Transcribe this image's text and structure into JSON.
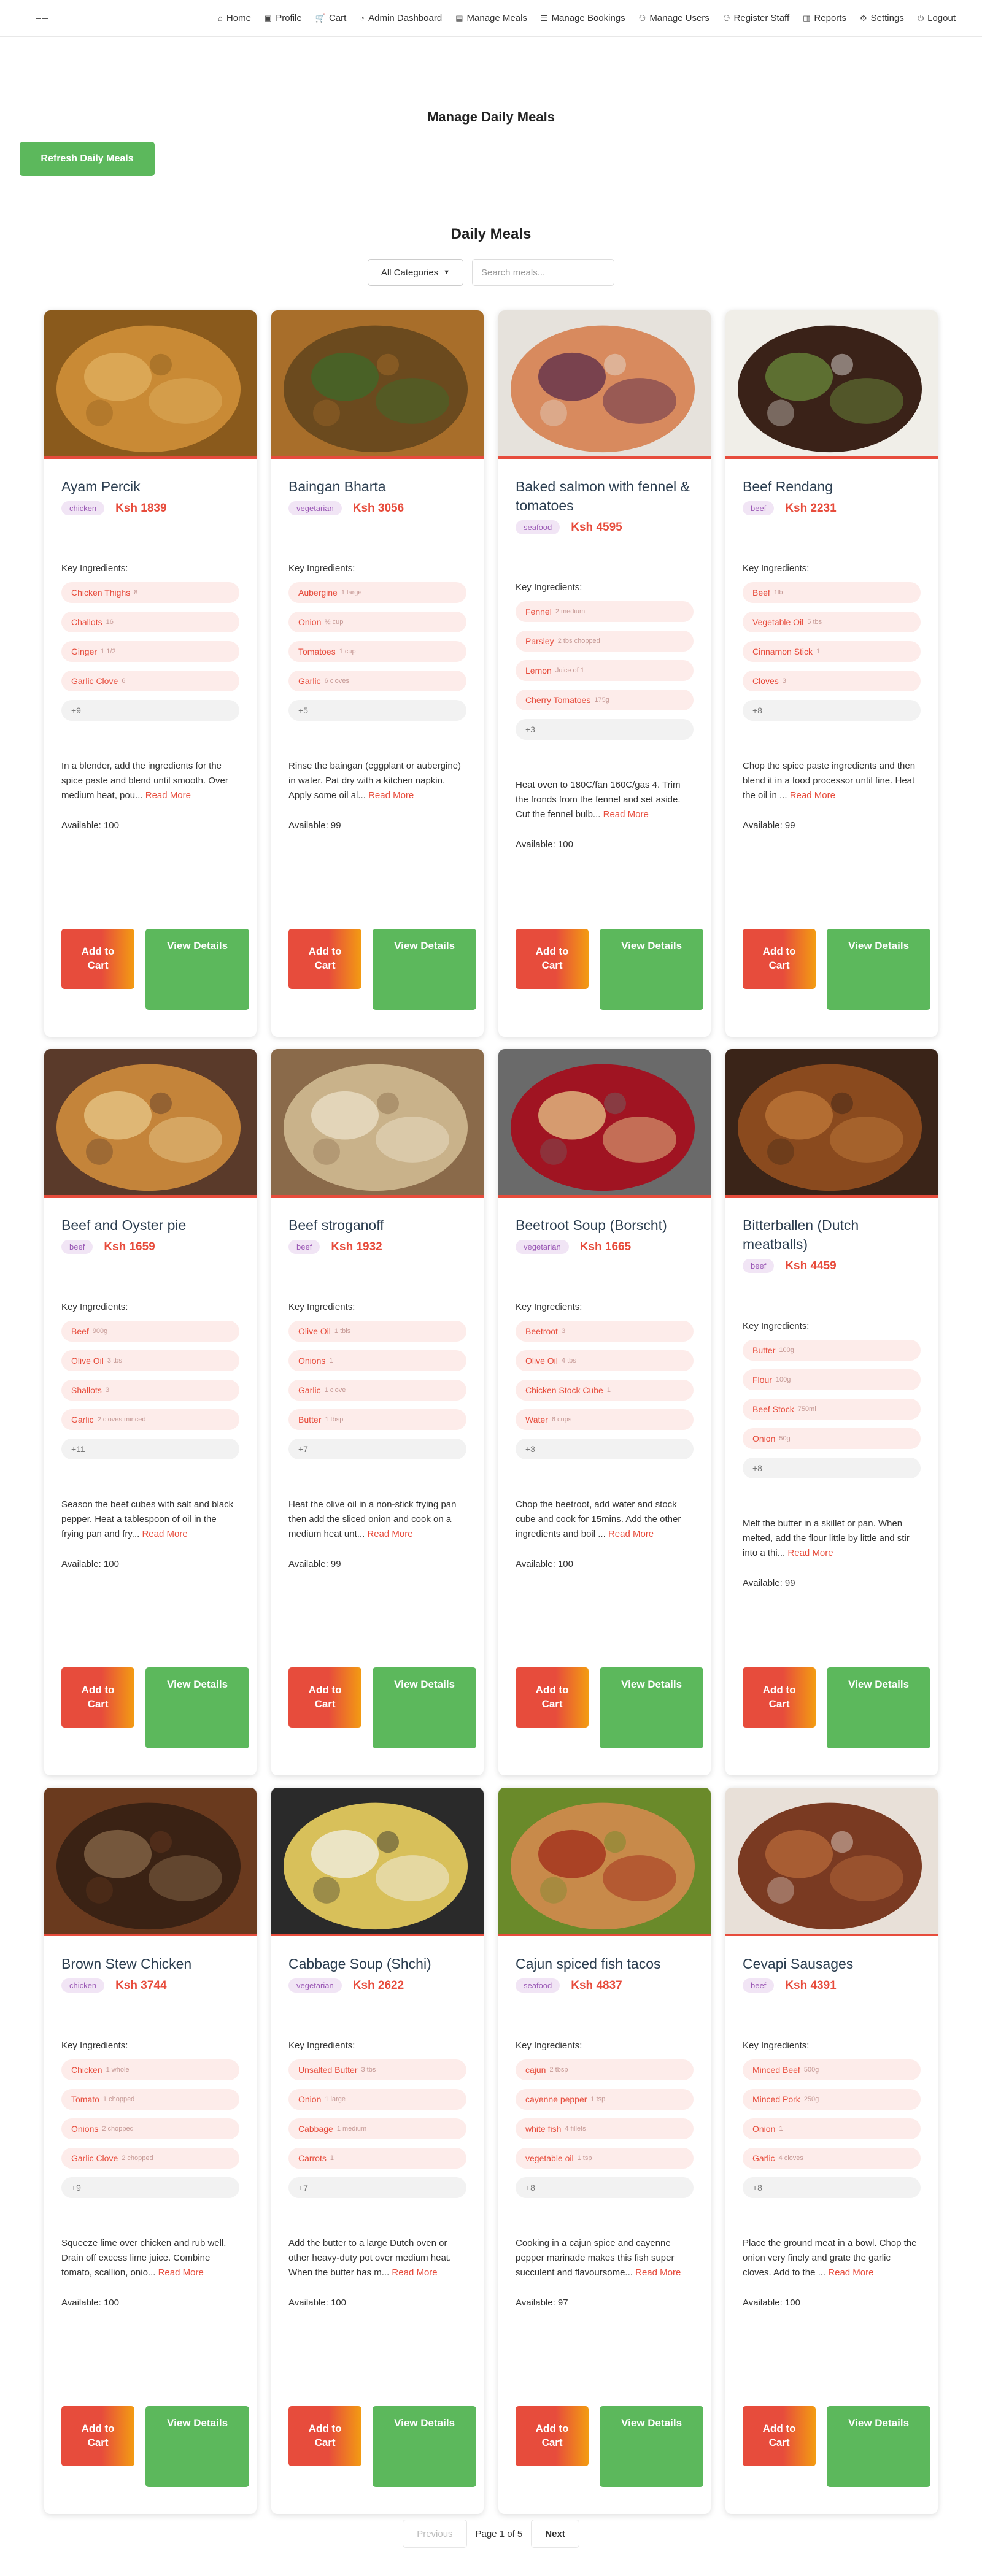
{
  "nav": {
    "items": [
      {
        "label": "Home",
        "icon": "home-icon",
        "glyph": "⌂"
      },
      {
        "label": "Profile",
        "icon": "profile-icon",
        "glyph": "▣"
      },
      {
        "label": "Cart",
        "icon": "cart-icon",
        "glyph": "🛒"
      },
      {
        "label": "Admin Dashboard",
        "icon": "dashboard-icon",
        "glyph": "◔"
      },
      {
        "label": "Manage Meals",
        "icon": "meals-icon",
        "glyph": "▤"
      },
      {
        "label": "Manage Bookings",
        "icon": "bookings-icon",
        "glyph": "☰"
      },
      {
        "label": "Manage Users",
        "icon": "users-icon",
        "glyph": "⚇"
      },
      {
        "label": "Register Staff",
        "icon": "register-icon",
        "glyph": "⚇"
      },
      {
        "label": "Reports",
        "icon": "reports-icon",
        "glyph": "▥"
      },
      {
        "label": "Settings",
        "icon": "settings-icon",
        "glyph": "⚙"
      },
      {
        "label": "Logout",
        "icon": "logout-icon",
        "glyph": "⏻"
      }
    ]
  },
  "page": {
    "title": "Manage Daily Meals",
    "refresh_label": "Refresh Daily Meals",
    "section_title": "Daily Meals",
    "category_select": "All Categories",
    "search_placeholder": "Search meals..."
  },
  "labels": {
    "key_ingredients": "Key Ingredients:",
    "read_more": "Read More",
    "add_to_cart": "Add to Cart",
    "view_details": "View Details"
  },
  "meals": [
    {
      "name": "Ayam Percik",
      "category": "chicken",
      "price": "Ksh 1839",
      "ingredients": [
        {
          "n": "Chicken Thighs",
          "q": "8"
        },
        {
          "n": "Challots",
          "q": "16"
        },
        {
          "n": "Ginger",
          "q": "1 1/2"
        },
        {
          "n": "Garlic Clove",
          "q": "6"
        }
      ],
      "more": "+9",
      "desc": "In a blender, add the ingredients for the spice paste and blend until smooth. Over medium heat, pou...",
      "available": "Available: 100",
      "colors": [
        "#c98a35",
        "#8a5a1c",
        "#e0b060"
      ]
    },
    {
      "name": "Baingan Bharta",
      "category": "vegetarian",
      "price": "Ksh 3056",
      "ingredients": [
        {
          "n": "Aubergine",
          "q": "1 large"
        },
        {
          "n": "Onion",
          "q": "½ cup"
        },
        {
          "n": "Tomatoes",
          "q": "1 cup"
        },
        {
          "n": "Garlic",
          "q": "6 cloves"
        }
      ],
      "more": "+5",
      "desc": "Rinse the baingan (eggplant or aubergine) in water. Pat dry with a kitchen napkin. Apply some oil al...",
      "available": "Available: 99",
      "colors": [
        "#6b4a1e",
        "#a86e2a",
        "#3d6a2a"
      ]
    },
    {
      "name": "Baked salmon with fennel & tomatoes",
      "category": "seafood",
      "price": "Ksh 4595",
      "ingredients": [
        {
          "n": "Fennel",
          "q": "2 medium"
        },
        {
          "n": "Parsley",
          "q": "2 tbs chopped"
        },
        {
          "n": "Lemon",
          "q": "Juice of 1"
        },
        {
          "n": "Cherry Tomatoes",
          "q": "175g"
        }
      ],
      "more": "+3",
      "desc": "Heat oven to 180C/fan 160C/gas 4. Trim the fronds from the fennel and set aside. Cut the fennel bulb...",
      "available": "Available: 100",
      "colors": [
        "#d88a5e",
        "#e6e2dc",
        "#5a2a4a"
      ]
    },
    {
      "name": "Beef Rendang",
      "category": "beef",
      "price": "Ksh 2231",
      "ingredients": [
        {
          "n": "Beef",
          "q": "1lb"
        },
        {
          "n": "Vegetable Oil",
          "q": "5 tbs"
        },
        {
          "n": "Cinnamon Stick",
          "q": "1"
        },
        {
          "n": "Cloves",
          "q": "3"
        }
      ],
      "more": "+8",
      "desc": "Chop the spice paste ingredients and then blend it in a food processor until fine. Heat the oil in ...",
      "available": "Available: 99",
      "colors": [
        "#3a2218",
        "#f0eee8",
        "#6a8a3a"
      ]
    },
    {
      "name": "Beef and Oyster pie",
      "category": "beef",
      "price": "Ksh 1659",
      "ingredients": [
        {
          "n": "Beef",
          "q": "900g"
        },
        {
          "n": "Olive Oil",
          "q": "3 tbs"
        },
        {
          "n": "Shallots",
          "q": "3"
        },
        {
          "n": "Garlic",
          "q": "2 cloves minced"
        }
      ],
      "more": "+11",
      "desc": "Season the beef cubes with salt and black pepper. Heat a tablespoon of oil in the frying pan and fry...",
      "available": "Available: 100",
      "colors": [
        "#c4843a",
        "#5a3a2a",
        "#e8c88a"
      ]
    },
    {
      "name": "Beef stroganoff",
      "category": "beef",
      "price": "Ksh 1932",
      "ingredients": [
        {
          "n": "Olive Oil",
          "q": "1 tbls"
        },
        {
          "n": "Onions",
          "q": "1"
        },
        {
          "n": "Garlic",
          "q": "1 clove"
        },
        {
          "n": "Butter",
          "q": "1 tbsp"
        }
      ],
      "more": "+7",
      "desc": "Heat the olive oil in a non-stick frying pan then add the sliced onion and cook on a medium heat unt...",
      "available": "Available: 99",
      "colors": [
        "#c9b28a",
        "#8a6a4a",
        "#ebe0c8"
      ]
    },
    {
      "name": "Beetroot Soup (Borscht)",
      "category": "vegetarian",
      "price": "Ksh 1665",
      "ingredients": [
        {
          "n": "Beetroot",
          "q": "3"
        },
        {
          "n": "Olive Oil",
          "q": "4 tbs"
        },
        {
          "n": "Chicken Stock Cube",
          "q": "1"
        },
        {
          "n": "Water",
          "q": "6 cups"
        }
      ],
      "more": "+3",
      "desc": "Chop the beetroot, add water and stock cube and cook for 15mins. Add the other ingredients and boil ...",
      "available": "Available: 100",
      "colors": [
        "#a01422",
        "#6a6a6a",
        "#e8c88a"
      ]
    },
    {
      "name": "Bitterballen (Dutch meatballs)",
      "category": "beef",
      "price": "Ksh 4459",
      "ingredients": [
        {
          "n": "Butter",
          "q": "100g"
        },
        {
          "n": "Flour",
          "q": "100g"
        },
        {
          "n": "Beef Stock",
          "q": "750ml"
        },
        {
          "n": "Onion",
          "q": "50g"
        }
      ],
      "more": "+8",
      "desc": "Melt the butter in a skillet or pan. When melted, add the flour little by little and stir into a thi...",
      "available": "Available: 99",
      "colors": [
        "#8a4a1e",
        "#3a2418",
        "#c07a3a"
      ]
    },
    {
      "name": "Brown Stew Chicken",
      "category": "chicken",
      "price": "Ksh 3744",
      "ingredients": [
        {
          "n": "Chicken",
          "q": "1 whole"
        },
        {
          "n": "Tomato",
          "q": "1 chopped"
        },
        {
          "n": "Onions",
          "q": "2 chopped"
        },
        {
          "n": "Garlic Clove",
          "q": "2 chopped"
        }
      ],
      "more": "+9",
      "desc": "Squeeze lime over chicken and rub well. Drain off excess lime juice. Combine tomato, scallion, onio...",
      "available": "Available: 100",
      "colors": [
        "#3a2214",
        "#6a3a1e",
        "#8a6a4a"
      ]
    },
    {
      "name": "Cabbage Soup (Shchi)",
      "category": "vegetarian",
      "price": "Ksh 2622",
      "ingredients": [
        {
          "n": "Unsalted Butter",
          "q": "3 tbs"
        },
        {
          "n": "Onion",
          "q": "1 large"
        },
        {
          "n": "Cabbage",
          "q": "1 medium"
        },
        {
          "n": "Carrots",
          "q": "1"
        }
      ],
      "more": "+7",
      "desc": "Add the butter to a large Dutch oven or other heavy-duty pot over medium heat. When the butter has m...",
      "available": "Available: 100",
      "colors": [
        "#d8c05a",
        "#2a2a2a",
        "#f2f0e8"
      ]
    },
    {
      "name": "Cajun spiced fish tacos",
      "category": "seafood",
      "price": "Ksh 4837",
      "ingredients": [
        {
          "n": "cajun",
          "q": "2 tbsp"
        },
        {
          "n": "cayenne pepper",
          "q": "1 tsp"
        },
        {
          "n": "white fish",
          "q": "4 fillets"
        },
        {
          "n": "vegetable oil",
          "q": "1 tsp"
        }
      ],
      "more": "+8",
      "desc": "Cooking in a cajun spice and cayenne pepper marinade makes this fish super succulent and flavoursome...",
      "available": "Available: 97",
      "colors": [
        "#c88a4a",
        "#6a8a2a",
        "#a02a1a"
      ]
    },
    {
      "name": "Cevapi Sausages",
      "category": "beef",
      "price": "Ksh 4391",
      "ingredients": [
        {
          "n": "Minced Beef",
          "q": "500g"
        },
        {
          "n": "Minced Pork",
          "q": "250g"
        },
        {
          "n": "Onion",
          "q": "1"
        },
        {
          "n": "Garlic",
          "q": "4 cloves"
        }
      ],
      "more": "+8",
      "desc": "Place the ground meat in a bowl. Chop the onion very finely and grate the garlic cloves. Add to the ...",
      "available": "Available: 100",
      "colors": [
        "#7a3a22",
        "#e8e0d8",
        "#b86a3a"
      ]
    }
  ],
  "pagination": {
    "prev_label": "Previous",
    "info": "Page 1 of 5",
    "next_label": "Next"
  }
}
